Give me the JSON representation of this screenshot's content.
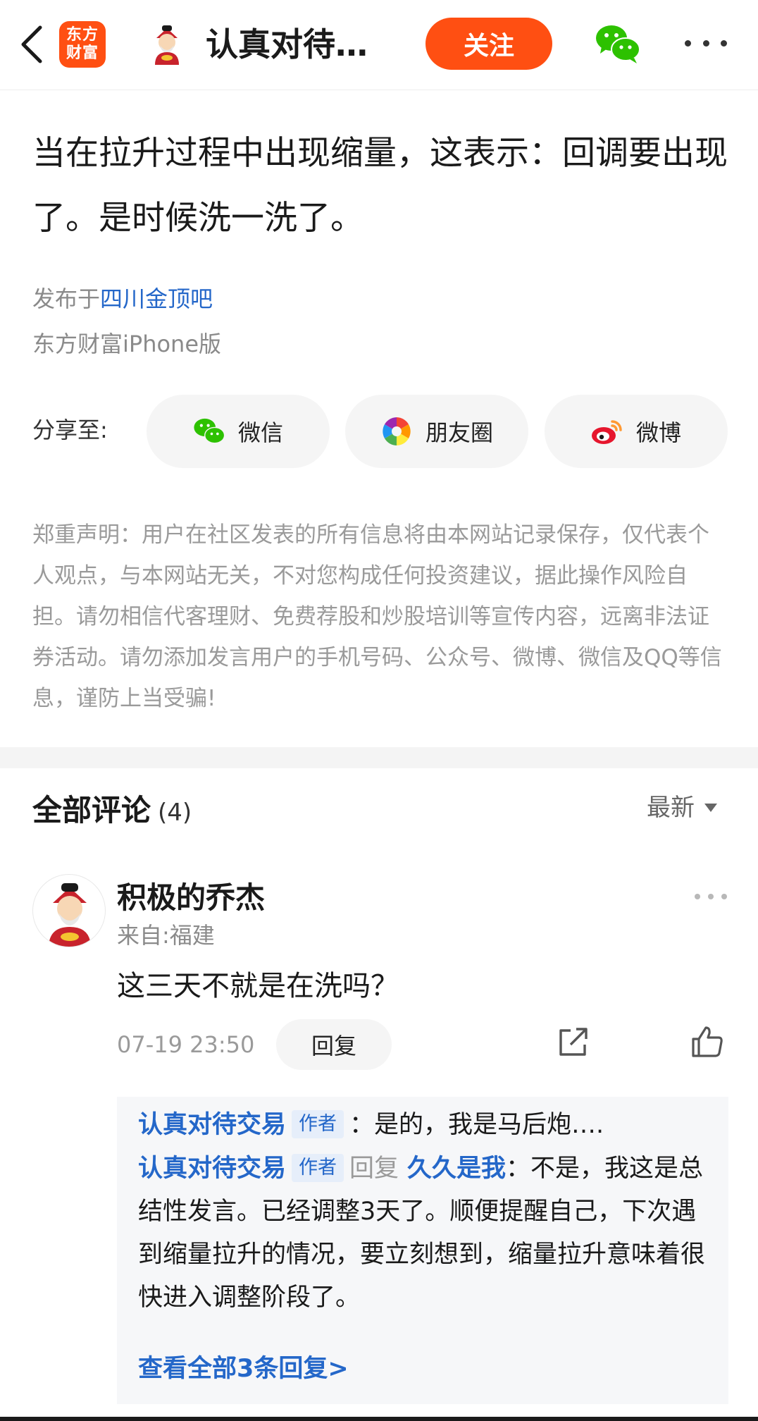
{
  "header": {
    "logo_text": "东方财富",
    "title": "认真对待…",
    "follow_label": "关注",
    "icons": [
      "chevron-left-icon",
      "wechat-icon",
      "more-icon"
    ]
  },
  "post": {
    "title": "当在拉升过程中出现缩量，这表示：回调要出现了。是时候洗一洗了。",
    "published_prefix": "发布于",
    "forum": "四川金顶吧",
    "client": "东方财富iPhone版"
  },
  "share": {
    "label": "分享至:",
    "wechat": "微信",
    "moments": "朋友圈",
    "weibo": "微博"
  },
  "disclaimer": "郑重声明：用户在社区发表的所有信息将由本网站记录保存，仅代表个人观点，与本网站无关，不对您构成任何投资建议，据此操作风险自担。请勿相信代客理财、免费荐股和炒股培训等宣传内容，远离非法证券活动。请勿添加发言用户的手机号码、公众号、微博、微信及QQ等信息，谨防上当受骗!",
  "comments": {
    "title": "全部评论",
    "count": "(4)",
    "sort_label": "最新",
    "items": [
      {
        "user": "积极的乔杰",
        "location": "来自:福建",
        "text": "这三天不就是在洗吗？",
        "time": "07-19 23:50",
        "reply_label": "回复",
        "replies": [
          {
            "user": "认真对待交易",
            "tag": "作者",
            "text": "：是的，我是马后炮….",
            "reply_word": "",
            "reply_to": ""
          },
          {
            "user": "认真对待交易",
            "tag": "作者",
            "reply_word": "回复",
            "reply_to": "久久是我",
            "text": "：不是，我这是总结性发言。已经调整3天了。顺便提醒自己，下次遇到缩量拉升的情况，要立刻想到，缩量拉升意味着很快进入调整阶段了。"
          }
        ],
        "view_all": "查看全部3条回复>"
      }
    ]
  },
  "colors": {
    "brand_orange": "#ff4f12",
    "link_blue": "#2467c9",
    "gray_text": "#8a8a8a"
  }
}
